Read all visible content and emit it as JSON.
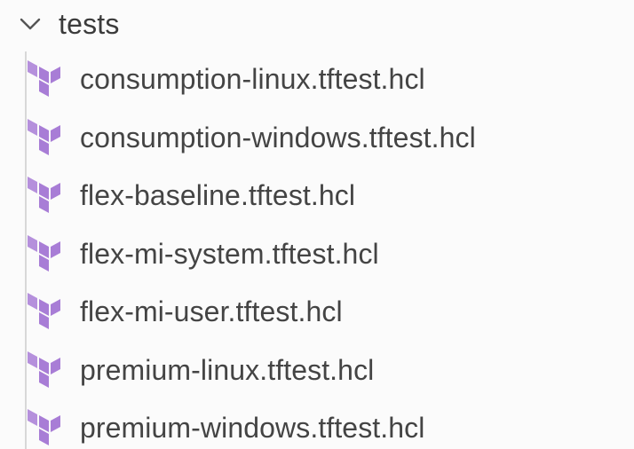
{
  "explorer": {
    "folder": {
      "label": "tests",
      "expanded": true,
      "chevron_icon": "chevron-down-icon"
    },
    "file_icon": "terraform-icon",
    "icon_color": "#a87dd6",
    "files": [
      {
        "label": "consumption-linux.tftest.hcl"
      },
      {
        "label": "consumption-windows.tftest.hcl"
      },
      {
        "label": "flex-baseline.tftest.hcl"
      },
      {
        "label": "flex-mi-system.tftest.hcl"
      },
      {
        "label": "flex-mi-user.tftest.hcl"
      },
      {
        "label": "premium-linux.tftest.hcl"
      },
      {
        "label": "premium-windows.tftest.hcl"
      }
    ]
  }
}
